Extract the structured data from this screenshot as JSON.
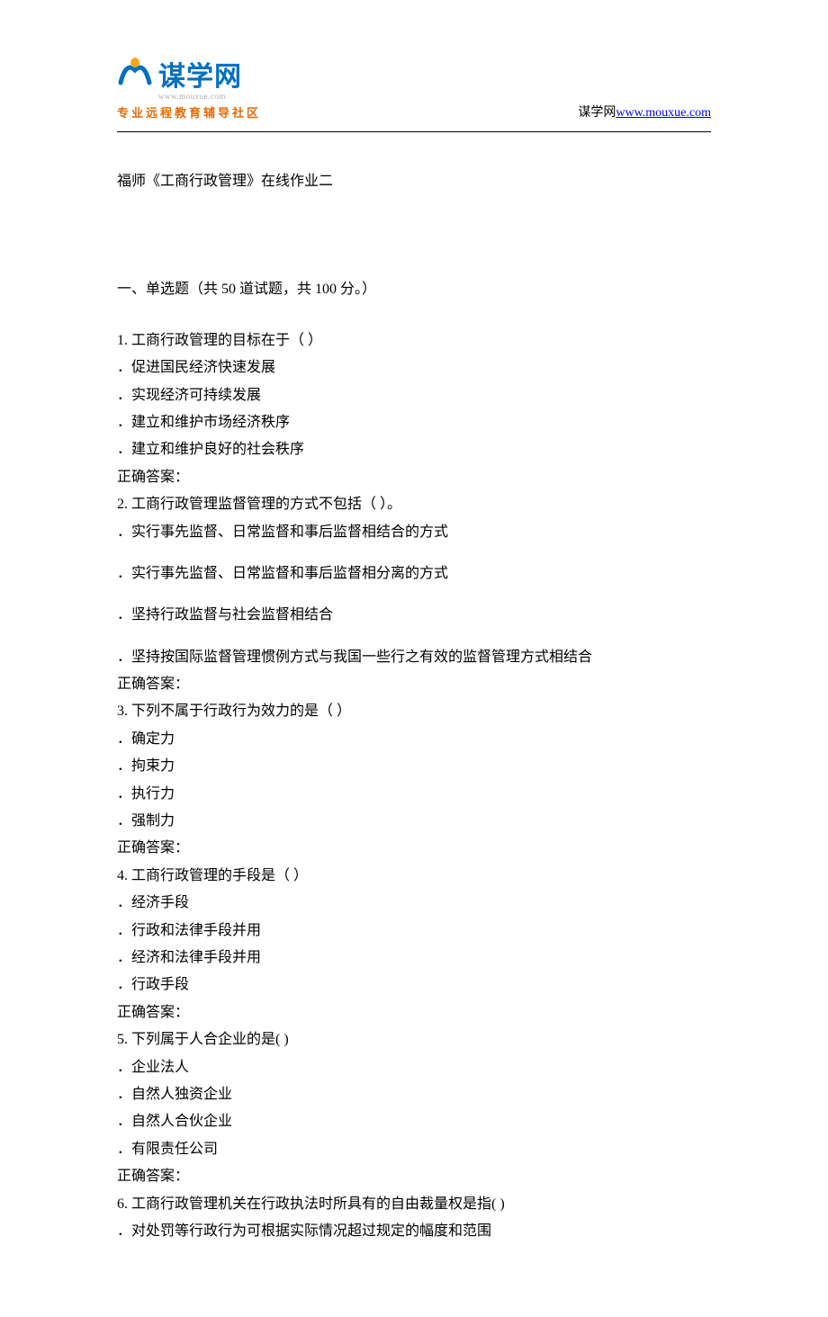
{
  "header": {
    "logo_text": "谋学网",
    "logo_url": "www.mouxue.com",
    "logo_tagline": "专业远程教育辅导社区",
    "right_prefix": "谋学网",
    "right_link_text": "www.mouxue.com"
  },
  "doc": {
    "title": "福师《工商行政管理》在线作业二",
    "section_intro": "一、单选题（共 50 道试题，共 100 分。）",
    "correct_answer_label": "正确答案：",
    "questions": [
      {
        "num": "1.",
        "stem": "工商行政管理的目标在于（ ）",
        "options": [
          "．促进国民经济快速发展",
          "．实现经济可持续发展",
          "．建立和维护市场经济秩序",
          "．建立和维护良好的社会秩序"
        ]
      },
      {
        "num": "2.",
        "stem": "工商行政管理监督管理的方式不包括（ ）。",
        "options": [
          "．实行事先监督、日常监督和事后监督相结合的方式",
          "．实行事先监督、日常监督和事后监督相分离的方式",
          "．坚持行政监督与社会监督相结合",
          "．坚持按国际监督管理惯例方式与我国一些行之有效的监督管理方式相结合"
        ],
        "spaced": true
      },
      {
        "num": "3.",
        "stem": "下列不属于行政行为效力的是（ ）",
        "options": [
          "．确定力",
          "．拘束力",
          "．执行力",
          "．强制力"
        ]
      },
      {
        "num": "4.",
        "stem": "工商行政管理的手段是（ ）",
        "options": [
          "．经济手段",
          "．行政和法律手段并用",
          "．经济和法律手段并用",
          "．行政手段"
        ]
      },
      {
        "num": "5.",
        "stem": "下列属于人合企业的是( )",
        "options": [
          "．企业法人",
          "．自然人独资企业",
          "．自然人合伙企业",
          "．有限责任公司"
        ]
      },
      {
        "num": "6.",
        "stem": "工商行政管理机关在行政执法时所具有的自由裁量权是指( )",
        "options": [
          "．对处罚等行政行为可根据实际情况超过规定的幅度和范围"
        ],
        "partial": true
      }
    ]
  }
}
